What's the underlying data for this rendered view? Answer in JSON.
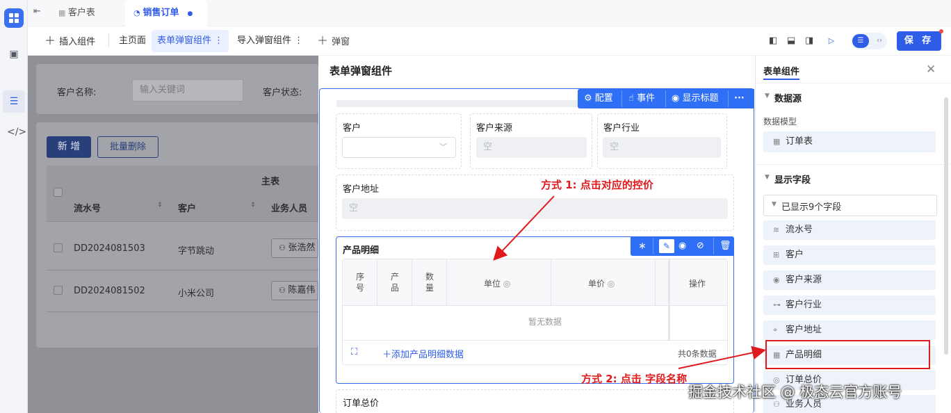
{
  "tabs": {
    "customer": "客户表",
    "sales_order": "销售订单"
  },
  "toolbar": {
    "insert": "插入组件",
    "home": "主页面",
    "form_modal": "表单弹窗组件",
    "import_modal": "导入弹窗组件",
    "add_modal": "弹窗",
    "save": "保 存"
  },
  "bg": {
    "customer_name_label": "客户名称:",
    "search_placeholder": "输入关键词",
    "customer_status_label": "客户状态:",
    "new_btn": "新 增",
    "batch_delete_btn": "批量删除",
    "main_table_group": "主表",
    "columns": [
      "流水号",
      "客户",
      "业务人员"
    ],
    "rows": [
      {
        "serial": "DD2024081503",
        "customer": "字节跳动",
        "staff": "张浩然"
      },
      {
        "serial": "DD2024081502",
        "customer": "小米公司",
        "staff": "陈嘉伟"
      }
    ]
  },
  "modal": {
    "title": "表单弹窗组件",
    "tools": {
      "config": "配置",
      "event": "事件",
      "show_title": "显示标题",
      "more": "···"
    },
    "customer_label": "客户",
    "source_label": "客户来源",
    "industry_label": "客户行业",
    "address_label": "客户地址",
    "empty": "空",
    "product_detail_label": "产品明细",
    "product_table_headers": [
      "序号",
      "产品",
      "数量",
      "单位",
      "单价",
      "操作"
    ],
    "no_data": "暂无数据",
    "add_product_row": "添加产品明细数据",
    "total_rows": "共0条数据",
    "order_total_label": "订单总价"
  },
  "right_panel": {
    "title": "表单组件",
    "data_source": "数据源",
    "data_model_label": "数据模型",
    "data_model_value": "订单表",
    "display_fields": "显示字段",
    "shown_count": "已显示9个字段",
    "fields": [
      "流水号",
      "客户",
      "客户来源",
      "客户行业",
      "客户地址",
      "产品明细",
      "订单总价",
      "业务人员"
    ]
  },
  "annotations": {
    "method1": "方式 1:  点击对应的控价",
    "method2": "方式 2:  点击 字段名称"
  },
  "watermark": "掘金技术社区 @ 极态云官方账号",
  "colors": {
    "accent": "#2f5de8",
    "annotation_red": "#e0191c"
  }
}
